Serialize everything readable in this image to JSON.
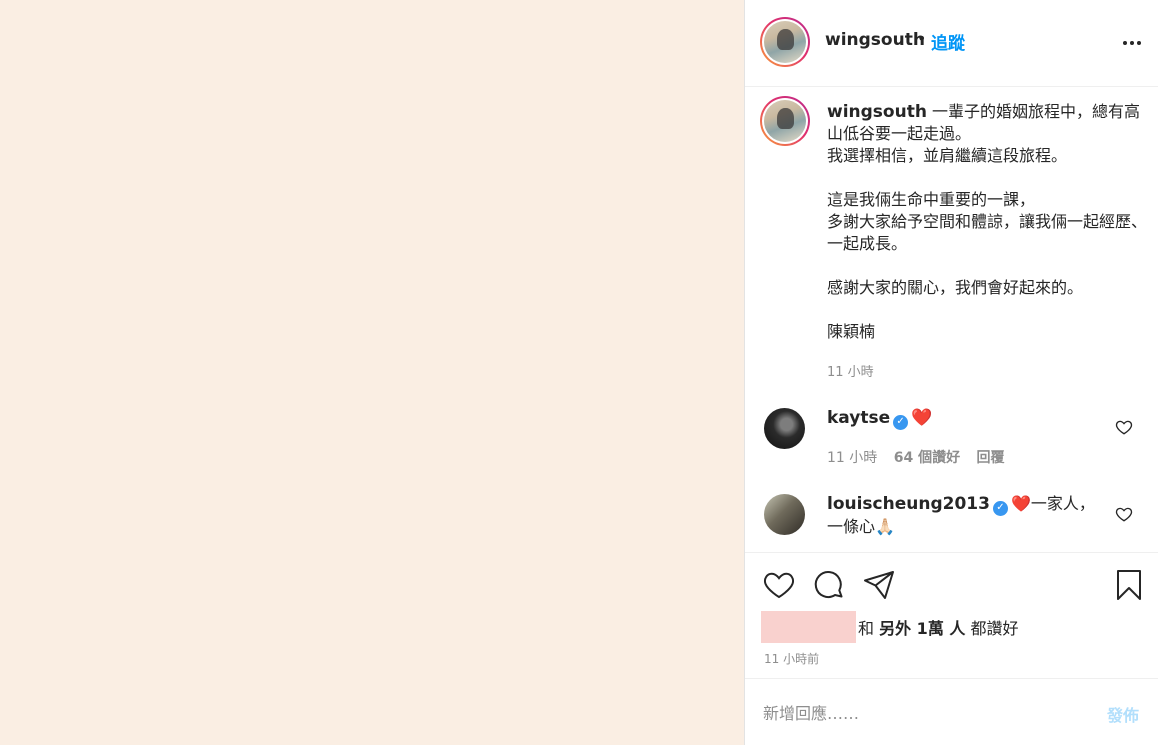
{
  "header": {
    "username": "wingsouth",
    "separator": "•",
    "follow_label": "追蹤",
    "more_icon": "more-options-icon"
  },
  "caption": {
    "username": "wingsouth",
    "lines": [
      "一輩子的婚姻旅程中，總有高山低谷要一起走過。",
      "我選擇相信，並肩繼續這段旅程。",
      "",
      "這是我倆生命中重要的一課，",
      "多謝大家給予空間和體諒，讓我倆一起經歷、一起成長。",
      "",
      "感謝大家的關心，我們會好起來的。",
      "",
      "陳穎楠"
    ],
    "time": "11 小時"
  },
  "comments": [
    {
      "username": "kaytse",
      "verified": true,
      "text": "❤️",
      "time": "11 小時",
      "likes": "64 個讚好",
      "reply": "回覆"
    },
    {
      "username": "louischeung2013",
      "verified": true,
      "text": "❤️一家人，一條心🙏🏻"
    }
  ],
  "actions": {
    "icons": [
      "heart-icon",
      "comment-icon",
      "share-icon",
      "bookmark-icon"
    ]
  },
  "likes": {
    "conjunction": "和",
    "others": "另外 1萬 人",
    "suffix": "都讚好"
  },
  "post_time": "11 小時前",
  "add_comment": {
    "placeholder": "新增回應……",
    "post_label": "發佈"
  },
  "colors": {
    "media_background": "#faeee3",
    "accent": "#0095f6",
    "post_button_disabled": "#b2dffc",
    "redaction": "#f9d1ce",
    "verified": "#3897f0"
  }
}
